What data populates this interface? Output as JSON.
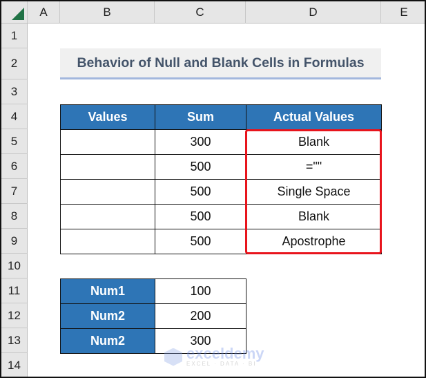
{
  "columns": [
    "A",
    "B",
    "C",
    "D",
    "E"
  ],
  "rows": [
    "1",
    "2",
    "3",
    "4",
    "5",
    "6",
    "7",
    "8",
    "9",
    "10",
    "11",
    "12",
    "13",
    "14"
  ],
  "title": "Behavior of Null and Blank Cells in Formulas",
  "table1": {
    "headers": [
      "Values",
      "Sum",
      "Actual Values"
    ],
    "rows": [
      {
        "value": "",
        "sum": "300",
        "actual": "Blank"
      },
      {
        "value": "",
        "sum": "500",
        "actual": "=\"\""
      },
      {
        "value": "",
        "sum": "500",
        "actual": "Single Space"
      },
      {
        "value": "",
        "sum": "500",
        "actual": "Blank"
      },
      {
        "value": "",
        "sum": "500",
        "actual": "Apostrophe"
      }
    ]
  },
  "table2": {
    "rows": [
      {
        "label": "Num1",
        "value": "100"
      },
      {
        "label": "Num2",
        "value": "200"
      },
      {
        "label": "Num2",
        "value": "300"
      }
    ]
  },
  "watermark": {
    "name": "exceldemy",
    "tagline": "EXCEL · DATA · BI"
  },
  "colors": {
    "header_fill": "#2e75b6",
    "highlight_border": "#e8141c",
    "title_text": "#44546a"
  }
}
